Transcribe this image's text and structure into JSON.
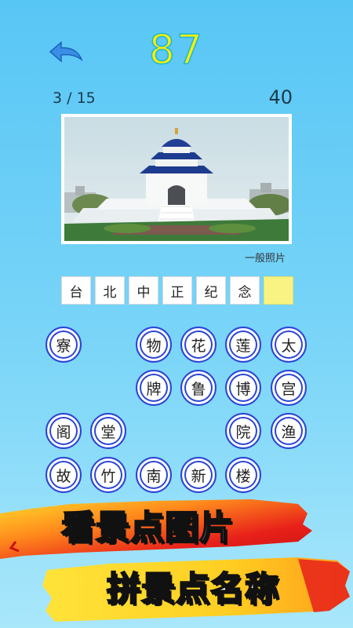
{
  "header": {
    "score": "87",
    "back_icon": "back-arrow-icon"
  },
  "status": {
    "progress": "3 / 15",
    "coins": "40"
  },
  "photo": {
    "caption": "一般照片",
    "subject": "monument-hall"
  },
  "answer": {
    "slots": [
      "台",
      "北",
      "中",
      "正",
      "纪",
      "念",
      ""
    ]
  },
  "letters": {
    "rows": [
      [
        "寮",
        "",
        "物",
        "花",
        "莲",
        "太"
      ],
      [
        "",
        "",
        "牌",
        "鲁",
        "博",
        "宫"
      ],
      [
        "阁",
        "堂",
        "",
        "",
        "院",
        "渔"
      ],
      [
        "故",
        "竹",
        "南",
        "新",
        "楼",
        ""
      ]
    ]
  },
  "promo": {
    "line1": "看景点图片",
    "line2": "拼景点名称"
  },
  "colors": {
    "background_top": "#58c6f5",
    "score": "#f6f000",
    "button_ring": "#2a45d6",
    "empty_slot": "#f9f383",
    "brush_red": "#e8201a",
    "brush_yellow": "#ffe33a"
  }
}
